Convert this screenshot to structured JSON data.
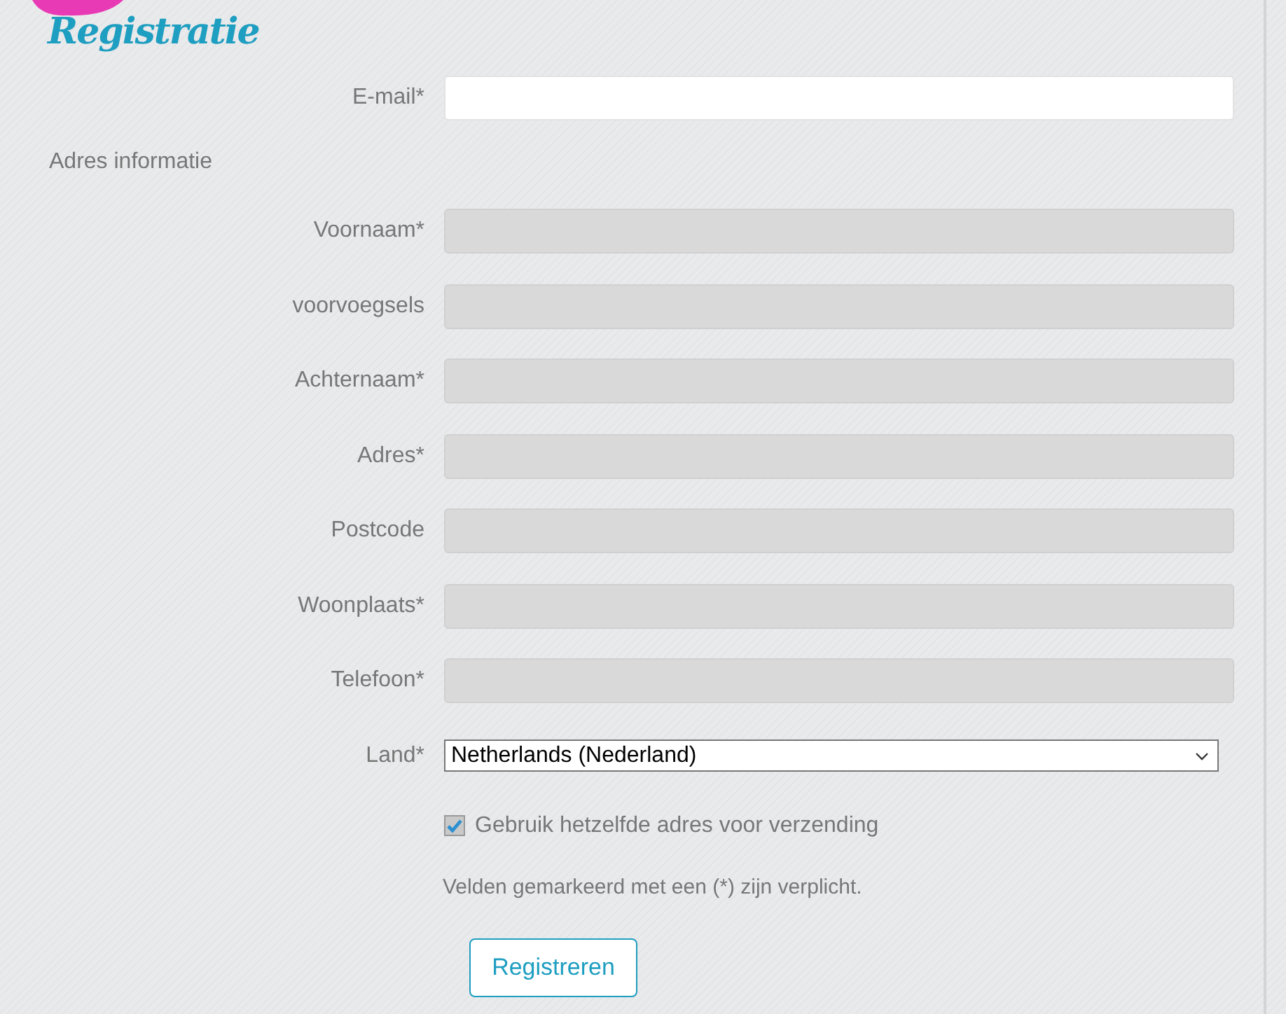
{
  "logo": {
    "text": "Registratie"
  },
  "email": {
    "label": "E-mail*",
    "disabled": false
  },
  "section_title": "Adres informatie",
  "fields": [
    {
      "label": "Voornaam*",
      "disabled": true
    },
    {
      "label": "voorvoegsels",
      "disabled": true
    },
    {
      "label": "Achternaam*",
      "disabled": true
    },
    {
      "label": "Adres*",
      "disabled": true
    },
    {
      "label": "Postcode",
      "disabled": true
    },
    {
      "label": "Woonplaats*",
      "disabled": true
    },
    {
      "label": "Telefoon*",
      "disabled": true
    }
  ],
  "country": {
    "label": "Land*",
    "value": "Netherlands (Nederland)"
  },
  "same_address": {
    "label": "Gebruik hetzelfde adres voor verzending",
    "checked": true
  },
  "note": "Velden gemarkeerd met een (*) zijn verplicht.",
  "submit": "Registreren"
}
